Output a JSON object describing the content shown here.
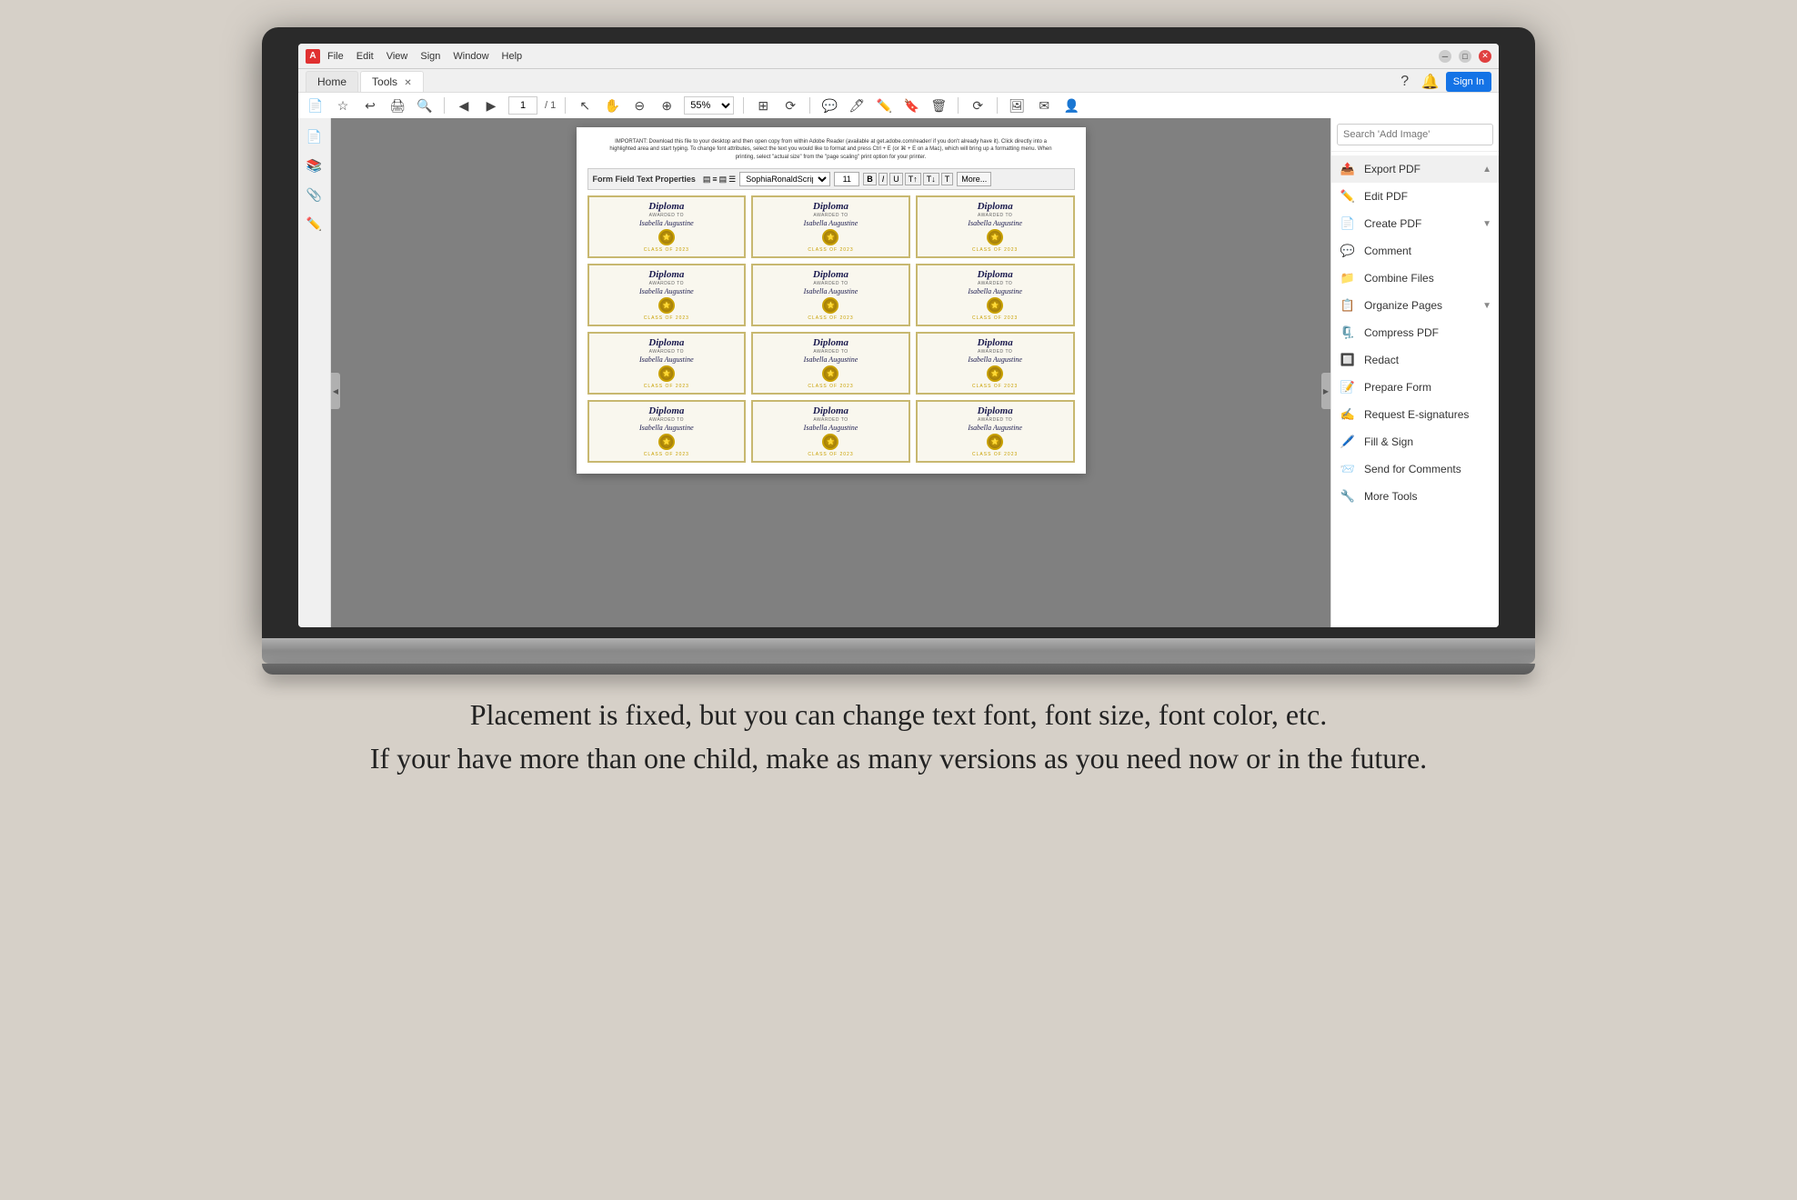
{
  "window": {
    "title": "Adobe Acrobat",
    "menu_items": [
      "File",
      "Edit",
      "View",
      "Sign",
      "Window",
      "Help"
    ]
  },
  "tabs": [
    {
      "label": "Home",
      "active": false
    },
    {
      "label": "Tools",
      "active": true
    }
  ],
  "toolbar": {
    "page_current": "1",
    "page_total": "1",
    "zoom": "55%",
    "sign_in": "Sign In"
  },
  "form_field": {
    "title": "Form Field Text Properties",
    "font": "SophiaRonaldScript",
    "size": "11",
    "more": "More..."
  },
  "pdf_notice": "IMPORTANT: Download this file to your desktop and then open copy from within Adobe Reader (available at get.adobe.com/reader/ if you don't already have it). Click directly into a highlighted area and start typing. To change font attributes, select the text you would like to format and press Ctrl + E (or ⌘ + E on a Mac), which will bring up a formatting menu. When printing, select \"actual size\" from the \"page scaling\" print option for your printer.",
  "diploma": {
    "title": "Diploma",
    "awarded_label": "AWARDED TO",
    "name": "Isabella Augustine",
    "class_label": "CLASS OF 2023",
    "count": 12
  },
  "right_panel": {
    "search_placeholder": "Search 'Add Image'",
    "tools": [
      {
        "label": "Export PDF",
        "icon": "📤",
        "color": "#e8472a",
        "expandable": true,
        "expanded": true
      },
      {
        "label": "Edit PDF",
        "icon": "✏️",
        "color": "#e8472a",
        "expandable": false
      },
      {
        "label": "Create PDF",
        "icon": "📄",
        "color": "#e8472a",
        "expandable": true
      },
      {
        "label": "Comment",
        "icon": "💬",
        "color": "#4a90d9",
        "expandable": false
      },
      {
        "label": "Combine Files",
        "icon": "📁",
        "color": "#e8472a",
        "expandable": false
      },
      {
        "label": "Organize Pages",
        "icon": "📋",
        "color": "#e8472a",
        "expandable": true
      },
      {
        "label": "Compress PDF",
        "icon": "🗜️",
        "color": "#e8472a",
        "expandable": false
      },
      {
        "label": "Redact",
        "icon": "🔲",
        "color": "#e8472a",
        "expandable": false
      },
      {
        "label": "Prepare Form",
        "icon": "📝",
        "color": "#e8472a",
        "expandable": false
      },
      {
        "label": "Request E-signatures",
        "icon": "✍️",
        "color": "#5b3a8e",
        "expandable": false
      },
      {
        "label": "Fill & Sign",
        "icon": "🖊️",
        "color": "#5b3a8e",
        "expandable": false
      },
      {
        "label": "Send for Comments",
        "icon": "📨",
        "color": "#e8472a",
        "expandable": false
      },
      {
        "label": "More Tools",
        "icon": "🔧",
        "color": "#5b3a8e",
        "expandable": false
      }
    ]
  },
  "caption": {
    "line1": "Placement is fixed, but you can change text font, font size, font color, etc.",
    "line2": "If your have more than one child, make as many versions as you need now or in the future."
  }
}
